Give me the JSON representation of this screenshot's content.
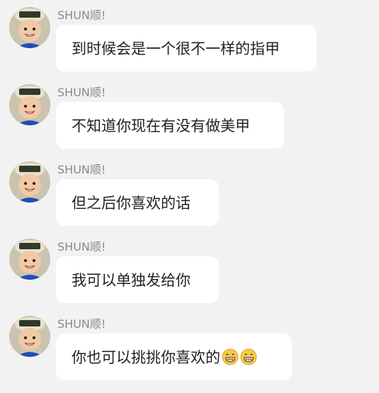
{
  "messages": [
    {
      "sender": "SHUN顺!",
      "text": "到时候会是一个很不一样的指甲",
      "emojis": []
    },
    {
      "sender": "SHUN顺!",
      "text": "不知道你现在有没有做美甲",
      "emojis": []
    },
    {
      "sender": "SHUN顺!",
      "text": "但之后你喜欢的话",
      "emojis": []
    },
    {
      "sender": "SHUN顺!",
      "text": "我可以单独发给你",
      "emojis": []
    },
    {
      "sender": "SHUN顺!",
      "text": "你也可以挑挑你喜欢的",
      "emojis": [
        "grinning-face-icon",
        "grinning-face-icon"
      ]
    }
  ],
  "colors": {
    "background": "#f2f2f2",
    "bubble": "#ffffff",
    "sender_name": "#8a8a8a",
    "message_text": "#222222"
  },
  "icons": {
    "avatar": "child-photo-avatar",
    "emoji": "grinning-face-icon"
  }
}
